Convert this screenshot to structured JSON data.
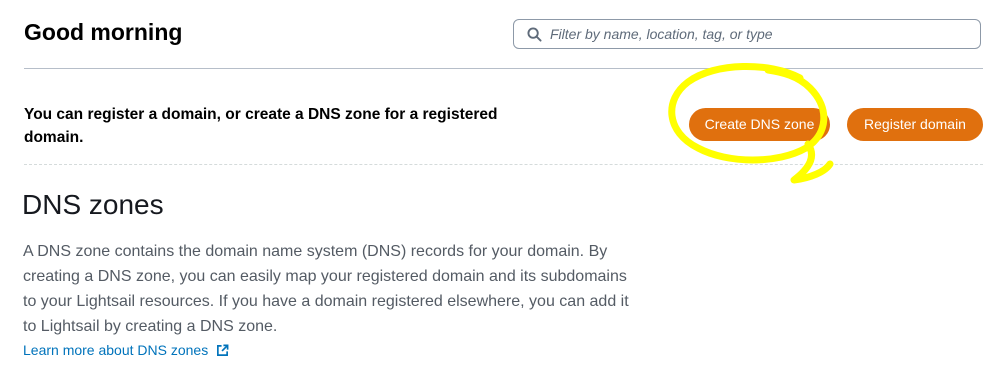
{
  "header": {
    "title": "Good morning",
    "search": {
      "placeholder": "Filter by name, location, tag, or type",
      "value": "",
      "icon": "search-icon"
    }
  },
  "notice": {
    "text": "You can register a domain, or create a DNS zone for a registered domain.",
    "create_button_label": "Create DNS zone",
    "register_button_label": "Register domain",
    "button_color": "#e0700e",
    "highlight_color": "#ffff00"
  },
  "section": {
    "title": "DNS zones",
    "description": "A DNS zone contains the domain name system (DNS) records for your domain. By creating a DNS zone, you can easily map your registered domain and its subdomains to your Lightsail resources. If you have a domain registered elsewhere, you can add it to Lightsail by creating a DNS zone.",
    "learn_more_label": "Learn more about DNS zones",
    "learn_more_icon": "external-link-icon",
    "link_color": "#0073bb"
  }
}
